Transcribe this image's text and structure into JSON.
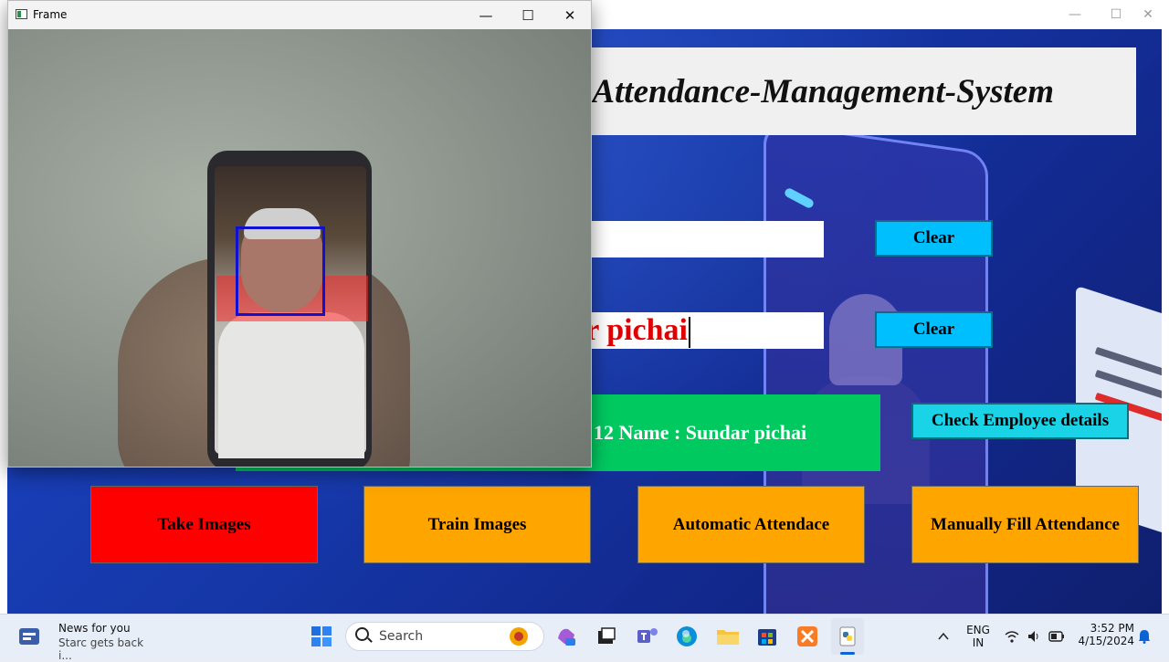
{
  "app_window": {
    "title": "Attendance-Management-System",
    "window_controls": {
      "minimize": "—",
      "maximize": "☐",
      "close": "✕"
    },
    "entry1": {
      "value": ""
    },
    "entry2": {
      "value": "r pichai"
    },
    "clear_button_1": "Clear",
    "clear_button_2": "Clear",
    "check_button": "Check Employee details",
    "notification": "12 Name : Sundar pichai",
    "buttons": {
      "take_images": "Take Images",
      "train_images": "Train Images",
      "automatic_attendance": "Automatic Attendace",
      "manual_attendance": "Manually Fill Attendance"
    },
    "colors": {
      "take_images": "#ff0000",
      "train_images": "#ffa500",
      "automatic_attendance": "#ffa500",
      "manual_attendance": "#ffa500",
      "notification_bg": "#00c960",
      "clear_bg": "#00bfff",
      "check_bg": "#1ad3e6"
    }
  },
  "frame_window": {
    "title": "Frame",
    "window_controls": {
      "minimize": "—",
      "maximize": "☐",
      "close": "✕"
    }
  },
  "taskbar": {
    "news": {
      "title": "News for you",
      "subtitle": "Starc gets back i..."
    },
    "search_label": "Search",
    "language": {
      "line1": "ENG",
      "line2": "IN"
    },
    "clock": {
      "time": "3:52 PM",
      "date": "4/15/2024"
    },
    "pinned_icons": [
      "start-icon",
      "search-icon",
      "copilot-icon",
      "task-view-icon",
      "teams-icon",
      "edge-icon",
      "file-explorer-icon",
      "store-icon",
      "xampp-icon",
      "python-icon"
    ]
  }
}
